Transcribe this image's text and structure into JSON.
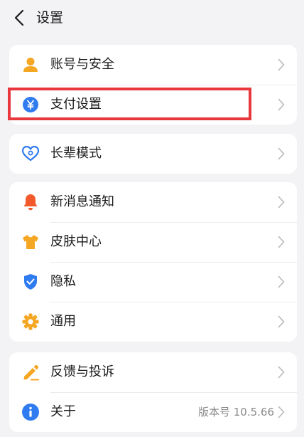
{
  "header": {
    "title": "设置"
  },
  "group_account": [
    {
      "key": "account",
      "label": "账号与安全",
      "icon": "person-icon"
    },
    {
      "key": "payment",
      "label": "支付设置",
      "icon": "yuan-icon"
    }
  ],
  "group_elder": [
    {
      "key": "elder",
      "label": "长辈模式",
      "icon": "heart-person-icon"
    }
  ],
  "group_general": [
    {
      "key": "notifications",
      "label": "新消息通知",
      "icon": "bell-icon"
    },
    {
      "key": "skin",
      "label": "皮肤中心",
      "icon": "tshirt-icon"
    },
    {
      "key": "privacy",
      "label": "隐私",
      "icon": "shield-check-icon"
    },
    {
      "key": "general",
      "label": "通用",
      "icon": "gear-icon"
    }
  ],
  "group_about": [
    {
      "key": "feedback",
      "label": "反馈与投诉",
      "icon": "pencil-icon"
    },
    {
      "key": "about",
      "label": "关于",
      "icon": "info-icon",
      "value": "版本号 10.5.66"
    }
  ],
  "colors": {
    "background": "#f3f3f5",
    "card": "#ffffff",
    "highlight": "#e8373d",
    "orange": "#f5a623",
    "blue": "#2f7bf0",
    "red_orange": "#f25a2c"
  }
}
